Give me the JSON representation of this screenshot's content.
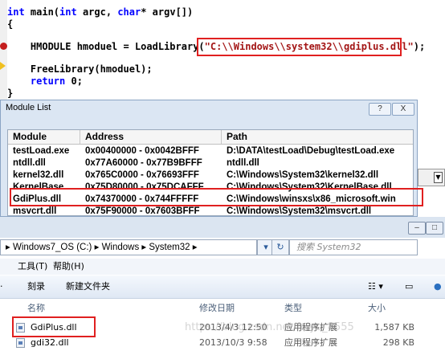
{
  "editor": {
    "lines": [
      "int main(int argc, char* argv[])",
      "{",
      "    HMODULE hmoduel = LoadLibrary(",
      "\"C:\\\\Windows\\\\system32\\\\gdiplus.dll\"",
      ");",
      "    FreeLibrary(hmoduel);",
      "    return 0;",
      "}"
    ]
  },
  "module_list": {
    "title": "Module List",
    "help_button": "?",
    "close_button": "X",
    "columns": [
      "Module",
      "Address",
      "Path"
    ],
    "rows": [
      {
        "module": "testLoad.exe",
        "address": "0x00400000 - 0x0042BFFF",
        "path": "D:\\DATA\\testLoad\\Debug\\testLoad.exe"
      },
      {
        "module": "ntdll.dll",
        "address": "0x77A60000 - 0x77B9BFFF",
        "path": "ntdll.dll"
      },
      {
        "module": "kernel32.dll",
        "address": "0x765C0000 - 0x76693FFF",
        "path": "C:\\Windows\\System32\\kernel32.dll"
      },
      {
        "module": "KernelBase....",
        "address": "0x75D80000 - 0x75DCAFFF",
        "path": "C:\\Windows\\System32\\KernelBase.dll"
      },
      {
        "module": "GdiPlus.dll",
        "address": "0x74370000 - 0x744FFFFF",
        "path": "C:\\Windows\\winsxs\\x86_microsoft.win"
      },
      {
        "module": "msvcrt.dll",
        "address": "0x75F90000 - 0x7603BFFF",
        "path": "C:\\Windows\\System32\\msvcrt.dll"
      }
    ]
  },
  "explorer": {
    "breadcrumb": [
      "Windows7_OS (C:)",
      "Windows",
      "System32"
    ],
    "search_placeholder": "搜索 System32",
    "menu": [
      "工具(T)",
      "帮助(H)"
    ],
    "toolbar": [
      "刻录",
      "新建文件夹"
    ],
    "columns": [
      "名称",
      "修改日期",
      "类型",
      "大小"
    ],
    "files": [
      {
        "name": "GdiPlus.dll",
        "date": "2013/4/3 12:50",
        "type": "应用程序扩展",
        "size": "1,587 KB"
      },
      {
        "name": "gdi32.dll",
        "date": "2013/10/3 9:58",
        "type": "应用程序扩展",
        "size": "298 KB"
      }
    ]
  },
  "watermark": "https://blog.csdn.net/feiyu_8555"
}
